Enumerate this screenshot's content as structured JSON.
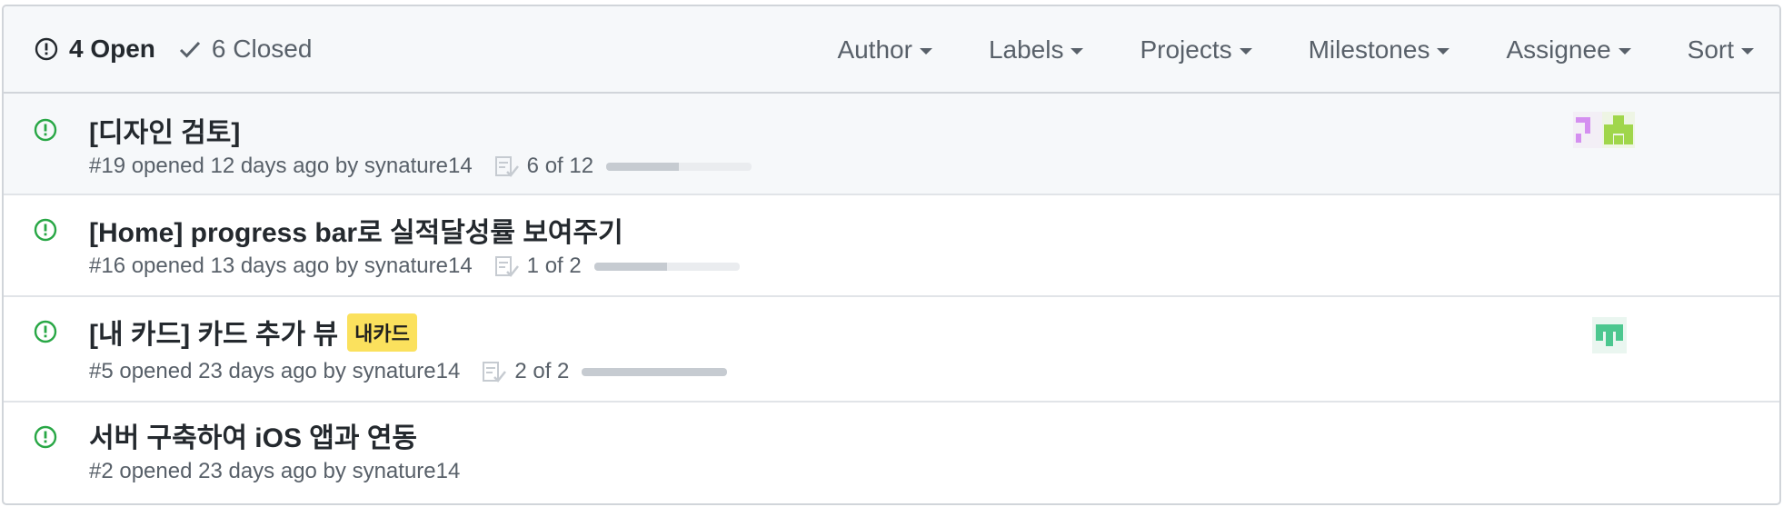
{
  "states": {
    "open_label": "4 Open",
    "closed_label": "6 Closed"
  },
  "filters": [
    "Author",
    "Labels",
    "Projects",
    "Milestones",
    "Assignee",
    "Sort"
  ],
  "issues": [
    {
      "title": "[디자인 검토]",
      "meta": "#19 opened 12 days ago by ",
      "author": "synature14",
      "tasks": "6 of 12",
      "progress": 0.5,
      "labels": [],
      "assignee_avatars": [
        "avatar-pink",
        "avatar-green"
      ]
    },
    {
      "title": "[Home] progress bar로 실적달성률 보여주기",
      "meta": "#16 opened 13 days ago by ",
      "author": "synature14",
      "tasks": "1 of 2",
      "progress": 0.5,
      "labels": [],
      "assignee_avatars": []
    },
    {
      "title": "[내 카드] 카드 추가 뷰",
      "meta": "#5 opened 23 days ago by ",
      "author": "synature14",
      "tasks": "2 of 2",
      "progress": 1.0,
      "labels": [
        "내카드"
      ],
      "assignee_avatars": [
        "avatar-teal"
      ]
    },
    {
      "title": "서버 구축하여 iOS 앱과 연동",
      "meta": "#2 opened 23 days ago by ",
      "author": "synature14",
      "tasks": "",
      "progress": null,
      "labels": [],
      "assignee_avatars": []
    }
  ],
  "colors": {
    "open_icon": "#28a745",
    "label_bg": "#fbe15d",
    "avatar_pink": "#d48ff0",
    "avatar_green": "#a0d64b",
    "avatar_teal": "#4cc78f"
  }
}
